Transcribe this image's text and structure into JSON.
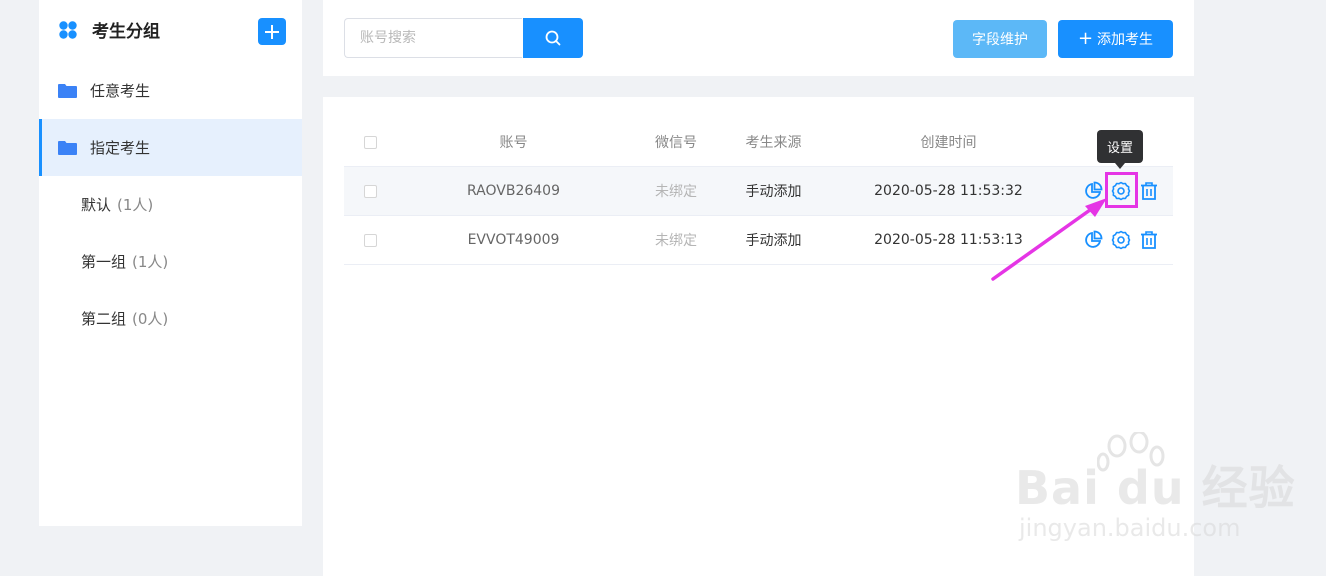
{
  "sidebar": {
    "title": "考生分组",
    "items": [
      {
        "label": "任意考生",
        "type": "top"
      },
      {
        "label": "指定考生",
        "type": "top",
        "active": true
      },
      {
        "label": "默认",
        "count": "(1人)",
        "type": "sub"
      },
      {
        "label": "第一组",
        "count": "(1人)",
        "type": "sub"
      },
      {
        "label": "第二组",
        "count": "(0人)",
        "type": "sub"
      }
    ]
  },
  "toolbar": {
    "search_placeholder": "账号搜索",
    "field_button": "字段维护",
    "add_button": "添加考生",
    "add_icon": "+"
  },
  "table": {
    "columns": [
      "账号",
      "微信号",
      "考生来源",
      "创建时间"
    ],
    "rows": [
      {
        "account": "RAOVB26409",
        "wechat": "未绑定",
        "source": "手动添加",
        "created": "2020-05-28 11:53:32"
      },
      {
        "account": "EVVOT49009",
        "wechat": "未绑定",
        "source": "手动添加",
        "created": "2020-05-28 11:53:13"
      }
    ]
  },
  "tooltip": {
    "text": "设置"
  },
  "watermark": {
    "text": "Bai du 经验",
    "sub": "jingyan.baidu.com"
  },
  "colors": {
    "primary": "#1890ff",
    "light_button": "#5cb8f7",
    "highlight": "#e535e5"
  }
}
